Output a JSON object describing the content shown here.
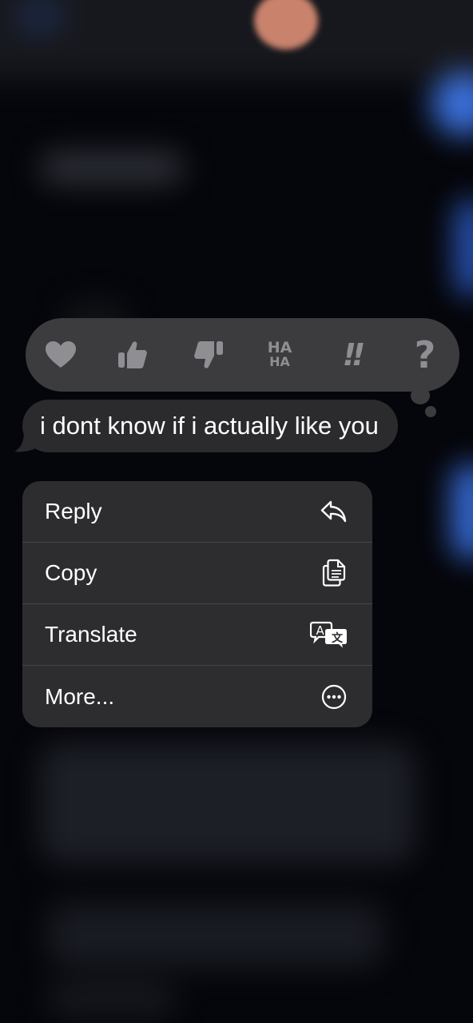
{
  "message": {
    "text": "i dont know if i actually like you"
  },
  "reactions": [
    {
      "name": "heart",
      "label": ""
    },
    {
      "name": "thumbs-up",
      "label": ""
    },
    {
      "name": "thumbs-down",
      "label": ""
    },
    {
      "name": "haha",
      "label": "HA HA",
      "line1": "HA",
      "line2": "HA"
    },
    {
      "name": "emphasize",
      "label": "!!"
    },
    {
      "name": "question",
      "label": "?"
    }
  ],
  "menu": {
    "items": [
      {
        "label": "Reply",
        "icon": "reply-icon"
      },
      {
        "label": "Copy",
        "icon": "copy-icon"
      },
      {
        "label": "Translate",
        "icon": "translate-icon"
      },
      {
        "label": "More...",
        "icon": "more-icon"
      }
    ]
  },
  "colors": {
    "background": "#05060b",
    "reaction_bar": "#3c3c3f",
    "bubble": "#2b2b2e",
    "menu": "#2d2d30",
    "icon_gray": "#8e8e93",
    "text": "#ffffff"
  }
}
